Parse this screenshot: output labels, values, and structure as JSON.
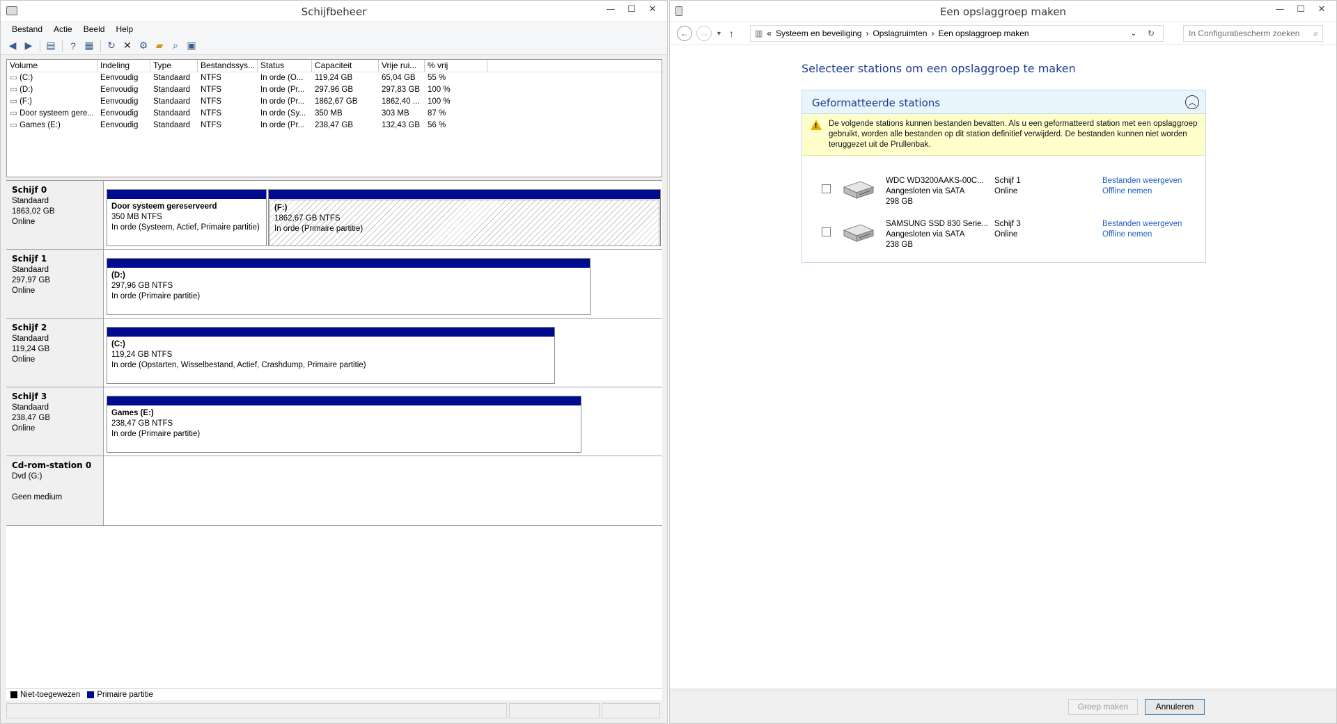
{
  "left_window": {
    "title": "Schijfbeheer",
    "menu": [
      "Bestand",
      "Actie",
      "Beeld",
      "Help"
    ],
    "columns": [
      "Volume",
      "Indeling",
      "Type",
      "Bestandssys...",
      "Status",
      "Capaciteit",
      "Vrije rui...",
      "% vrij"
    ],
    "volumes": [
      [
        "(C:)",
        "Eenvoudig",
        "Standaard",
        "NTFS",
        "In orde (O...",
        "119,24 GB",
        "65,04 GB",
        "55 %"
      ],
      [
        "(D:)",
        "Eenvoudig",
        "Standaard",
        "NTFS",
        "In orde (Pr...",
        "297,96 GB",
        "297,83 GB",
        "100 %"
      ],
      [
        "(F:)",
        "Eenvoudig",
        "Standaard",
        "NTFS",
        "In orde (Pr...",
        "1862,67 GB",
        "1862,40 ...",
        "100 %"
      ],
      [
        "Door systeem gere...",
        "Eenvoudig",
        "Standaard",
        "NTFS",
        "In orde (Sy...",
        "350 MB",
        "303 MB",
        "87 %"
      ],
      [
        "Games (E:)",
        "Eenvoudig",
        "Standaard",
        "NTFS",
        "In orde (Pr...",
        "238,47 GB",
        "132,43 GB",
        "56 %"
      ]
    ],
    "disks": [
      {
        "name": "Schijf 0",
        "type": "Standaard",
        "size": "1863,02 GB",
        "state": "Online",
        "parts": [
          {
            "title": "Door systeem gereserveerd",
            "size": "350 MB NTFS",
            "status": "In orde (Systeem, Actief, Primaire partitie)"
          },
          {
            "title": "(F:)",
            "size": "1862,67 GB NTFS",
            "status": "In orde (Primaire partitie)"
          }
        ]
      },
      {
        "name": "Schijf 1",
        "type": "Standaard",
        "size": "297,97 GB",
        "state": "Online",
        "parts": [
          {
            "title": "(D:)",
            "size": "297,96 GB NTFS",
            "status": "In orde (Primaire partitie)"
          }
        ]
      },
      {
        "name": "Schijf 2",
        "type": "Standaard",
        "size": "119,24 GB",
        "state": "Online",
        "parts": [
          {
            "title": "(C:)",
            "size": "119,24 GB NTFS",
            "status": "In orde (Opstarten, Wisselbestand, Actief, Crashdump, Primaire partitie)"
          }
        ]
      },
      {
        "name": "Schijf 3",
        "type": "Standaard",
        "size": "238,47 GB",
        "state": "Online",
        "parts": [
          {
            "title": "Games  (E:)",
            "size": "238,47 GB NTFS",
            "status": "In orde (Primaire partitie)"
          }
        ]
      },
      {
        "name": "Cd-rom-station 0",
        "type": "Dvd (G:)",
        "size": "",
        "state": "Geen medium"
      }
    ],
    "legend": {
      "unallocated": "Niet-toegewezen",
      "primary": "Primaire partitie"
    },
    "colors": {
      "primary": "#000c8e",
      "unallocated": "#000000"
    }
  },
  "right_window": {
    "title": "Een opslaggroep maken",
    "breadcrumb": [
      "Systeem en beveiliging",
      "Opslagruimten",
      "Een opslaggroep maken"
    ],
    "breadcrumb_prefix": "«",
    "search_placeholder": "In Configuratiescherm zoeken",
    "heading": "Selecteer stations om een opslaggroep te maken",
    "group_title": "Geformatteerde stations",
    "warning": "De volgende stations kunnen bestanden bevatten. Als u een geformatteerd station met een opslaggroep gebruikt, worden alle bestanden op dit station definitief verwijderd. De bestanden kunnen niet worden teruggezet uit de Prullenbak.",
    "drives": [
      {
        "name": "WDC WD3200AAKS-00C...",
        "connection": "Aangesloten via SATA",
        "size": "298 GB",
        "disk": "Schijf 1",
        "state": "Online",
        "link1": "Bestanden weergeven",
        "link2": "Offline nemen"
      },
      {
        "name": "SAMSUNG SSD 830 Serie...",
        "connection": "Aangesloten via SATA",
        "size": "238 GB",
        "disk": "Schijf 3",
        "state": "Online",
        "link1": "Bestanden weergeven",
        "link2": "Offline nemen"
      }
    ],
    "buttons": {
      "create": "Groep maken",
      "cancel": "Annuleren"
    },
    "colors": {
      "heading": "#1e3e8c",
      "link": "#1f5fc3",
      "warning_bg": "#ffffcc"
    }
  }
}
